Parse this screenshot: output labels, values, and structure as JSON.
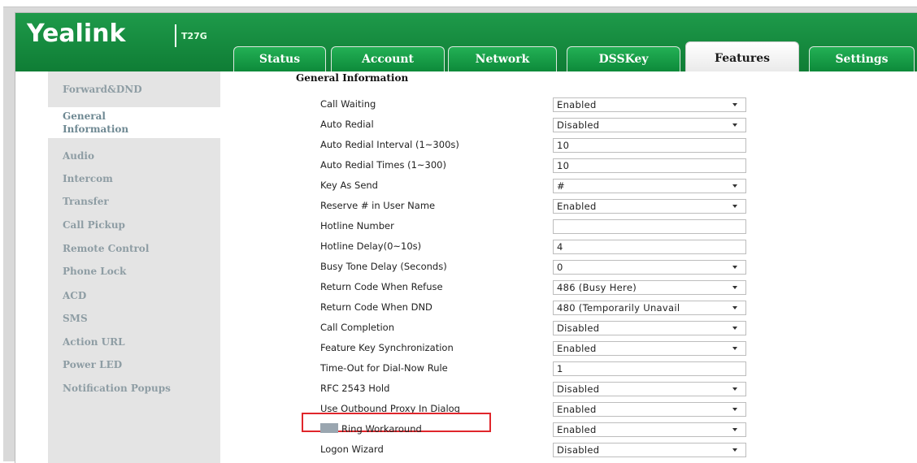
{
  "header": {
    "brand": "Yealink",
    "model": "T27G",
    "tabs": [
      "Status",
      "Account",
      "Network",
      "DSSKey",
      "Features",
      "Settings"
    ],
    "active_tab": "Features"
  },
  "sidebar": {
    "items": [
      {
        "label": "Forward&DND"
      },
      {
        "label": "General Information",
        "line1": "General",
        "line2": "Information",
        "active": true
      },
      {
        "label": "Audio"
      },
      {
        "label": "Intercom"
      },
      {
        "label": "Transfer"
      },
      {
        "label": "Call Pickup"
      },
      {
        "label": "Remote Control"
      },
      {
        "label": "Phone Lock"
      },
      {
        "label": "ACD"
      },
      {
        "label": "SMS"
      },
      {
        "label": "Action URL"
      },
      {
        "label": "Power LED"
      },
      {
        "label": "Notification Popups"
      }
    ]
  },
  "main": {
    "section_title": "General Information",
    "rows": [
      {
        "label": "Call Waiting",
        "value": "Enabled",
        "type": "select"
      },
      {
        "label": "Auto Redial",
        "value": "Disabled",
        "type": "select"
      },
      {
        "label": "Auto Redial Interval (1~300s)",
        "value": "10",
        "type": "input"
      },
      {
        "label": "Auto Redial Times (1~300)",
        "value": "10",
        "type": "input"
      },
      {
        "label": "Key As Send",
        "value": "#",
        "type": "select"
      },
      {
        "label": "Reserve # in User Name",
        "value": "Enabled",
        "type": "select"
      },
      {
        "label": "Hotline Number",
        "value": "",
        "type": "input"
      },
      {
        "label": "Hotline Delay(0~10s)",
        "value": "4",
        "type": "input"
      },
      {
        "label": "Busy Tone Delay (Seconds)",
        "value": "0",
        "type": "select"
      },
      {
        "label": "Return Code When Refuse",
        "value": "486 (Busy Here)",
        "type": "select"
      },
      {
        "label": "Return Code When DND",
        "value": "480 (Temporarily Unavail",
        "type": "select"
      },
      {
        "label": "Call Completion",
        "value": "Disabled",
        "type": "select"
      },
      {
        "label": "Feature Key Synchronization",
        "value": "Enabled",
        "type": "select"
      },
      {
        "label": "Time-Out for Dial-Now Rule",
        "value": "1",
        "type": "input"
      },
      {
        "label": "RFC 2543 Hold",
        "value": "Disabled",
        "type": "select"
      },
      {
        "label": "Use Outbound Proxy In Dialog",
        "value": "Enabled",
        "type": "select"
      },
      {
        "label": "Ring Workaround",
        "value": "Enabled",
        "type": "select",
        "highlighted": true
      },
      {
        "label": "Logon Wizard",
        "value": "Disabled",
        "type": "select"
      }
    ]
  },
  "colors": {
    "header_green": "#13893e",
    "highlight": "#e0262b",
    "sidebar_bg": "#e4e4e4",
    "sidebar_text": "#8e9da4"
  }
}
